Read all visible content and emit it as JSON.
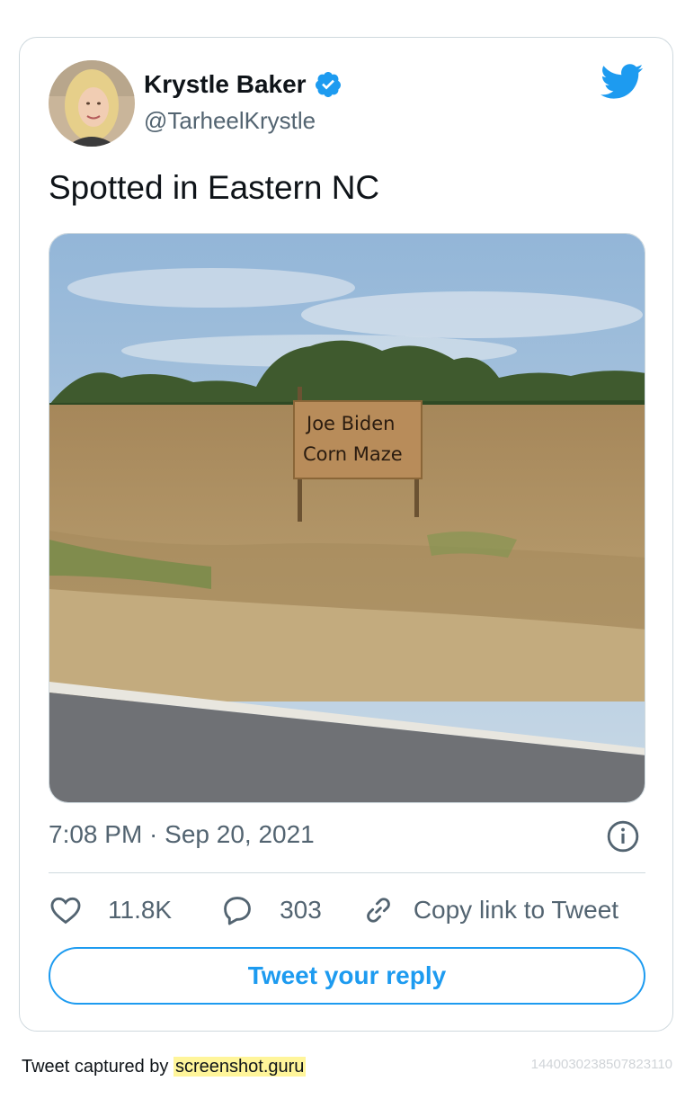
{
  "author": {
    "display_name": "Krystle Baker",
    "handle": "@TarheelKrystle",
    "verified": true
  },
  "tweet": {
    "text": "Spotted in Eastern NC",
    "image": {
      "sign_line1": "Joe Biden",
      "sign_line2": "Corn Maze"
    },
    "timestamp": "7:08 PM · Sep 20, 2021",
    "likes": "11.8K",
    "replies": "303",
    "copy_link_label": "Copy link to Tweet",
    "reply_button_label": "Tweet your reply"
  },
  "footer": {
    "captured_prefix": "Tweet captured by",
    "captured_site": "screenshot.guru",
    "tweet_id": "1440030238507823110"
  },
  "colors": {
    "accent": "#1d9bf0",
    "secondary_text": "#536471",
    "border": "#cfd9de",
    "highlight": "#fff59a"
  },
  "icons": {
    "verified": "verified-badge-icon",
    "brand": "twitter-bird-icon",
    "info": "info-icon",
    "like": "heart-icon",
    "reply": "speech-bubble-icon",
    "copy": "link-icon"
  }
}
